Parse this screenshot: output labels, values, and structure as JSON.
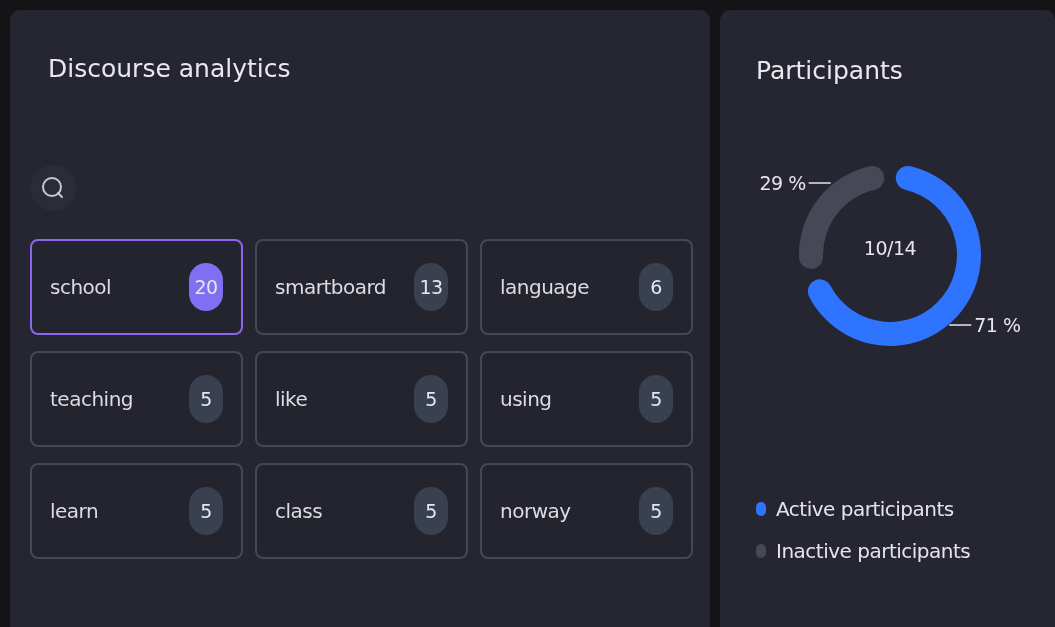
{
  "discourse": {
    "title": "Discourse analytics",
    "terms": [
      {
        "label": "school",
        "count": "20",
        "selected": true
      },
      {
        "label": "smartboard",
        "count": "13",
        "selected": false
      },
      {
        "label": "language",
        "count": "6",
        "selected": false
      },
      {
        "label": "teaching",
        "count": "5",
        "selected": false
      },
      {
        "label": "like",
        "count": "5",
        "selected": false
      },
      {
        "label": "using",
        "count": "5",
        "selected": false
      },
      {
        "label": "learn",
        "count": "5",
        "selected": false
      },
      {
        "label": "class",
        "count": "5",
        "selected": false
      },
      {
        "label": "norway",
        "count": "5",
        "selected": false
      }
    ]
  },
  "participants": {
    "chart_data": {
      "type": "donut",
      "title": "Participants",
      "categories": [
        "Active participants",
        "Inactive participants"
      ],
      "values": [
        71,
        29
      ],
      "colors": [
        "#2f74ff",
        "#464955"
      ],
      "value_labels": [
        "71 %",
        "29 %"
      ],
      "annotations": [
        "10/14"
      ]
    }
  }
}
